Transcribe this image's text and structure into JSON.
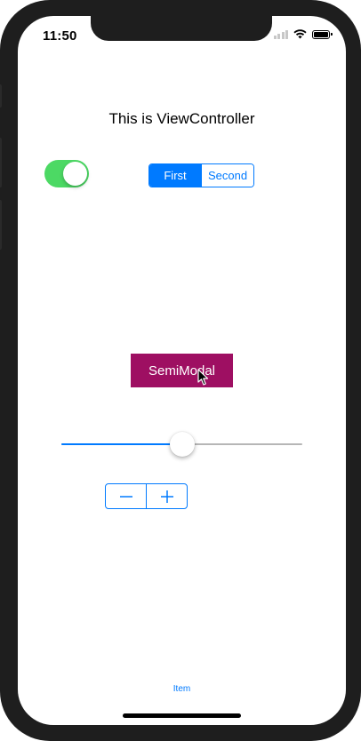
{
  "status_bar": {
    "time": "11:50"
  },
  "view": {
    "title": "This is ViewController"
  },
  "toggle": {
    "on": true,
    "color": "#4cd964"
  },
  "segmented_control": {
    "segments": [
      "First",
      "Second"
    ],
    "selected_index": 0,
    "accent": "#007aff"
  },
  "semi_modal_button": {
    "label": "SemiModal",
    "color": "#9e0f62"
  },
  "slider": {
    "value": 0.5
  },
  "stepper": {
    "minus_icon": "minus-icon",
    "plus_icon": "plus-icon"
  },
  "tab_bar": {
    "item_label": "Item"
  }
}
